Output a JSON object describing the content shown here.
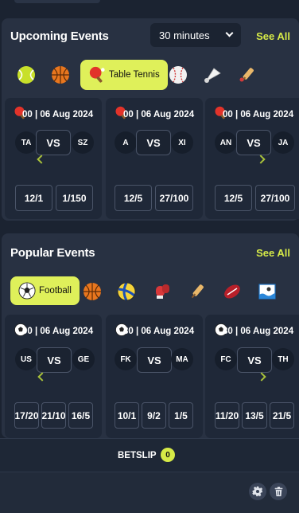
{
  "upcoming": {
    "title": "Upcoming Events",
    "filter_value": "30 minutes",
    "see_all": "See All",
    "active_sport": "Table Tennis",
    "sports": [
      "tennis",
      "basketball",
      "table-tennis",
      "baseball",
      "badminton",
      "cricket"
    ],
    "cards": [
      {
        "datetime": "00 | 06 Aug 2024",
        "home": "TA",
        "away": "SZ",
        "vs": "VS",
        "odds": [
          "12/1",
          "1/150"
        ]
      },
      {
        "datetime": "00 | 06 Aug 2024",
        "home": "A",
        "away": "XI",
        "vs": "VS",
        "odds": [
          "12/5",
          "27/100"
        ]
      },
      {
        "datetime": "00 | 06 Aug 2024",
        "home": "AN",
        "away": "JA",
        "vs": "VS",
        "odds": [
          "12/5",
          "27/100"
        ]
      }
    ]
  },
  "popular": {
    "title": "Popular Events",
    "see_all": "See All",
    "active_sport": "Football",
    "sports": [
      "football",
      "basketball",
      "volleyball",
      "boxing",
      "cricket",
      "rugby",
      "water-polo"
    ],
    "cards": [
      {
        "datetime": "00 | 06 Aug 2024",
        "home": "US",
        "away": "GE",
        "vs": "VS",
        "odds": [
          "17/20",
          "21/10",
          "16/5"
        ]
      },
      {
        "datetime": "30 | 06 Aug 2024",
        "home": "FK",
        "away": "MA",
        "vs": "VS",
        "odds": [
          "10/1",
          "9/2",
          "1/5"
        ]
      },
      {
        "datetime": "30 | 06 Aug 2024",
        "home": "FC",
        "away": "TH",
        "vs": "VS",
        "odds": [
          "11/20",
          "13/5",
          "21/5"
        ]
      }
    ]
  },
  "betslip": {
    "label": "BETSLIP",
    "count": "0"
  },
  "colors": {
    "accent": "#d6ea47",
    "background": "#1b2331",
    "panel": "#283142"
  }
}
